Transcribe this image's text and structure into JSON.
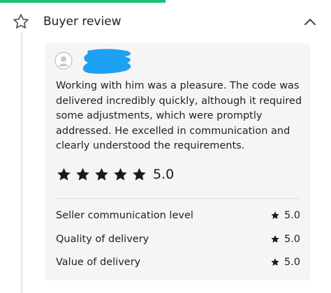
{
  "progress": {
    "fraction": 0.5,
    "color": "#1dbf73"
  },
  "header": {
    "title": "Buyer review",
    "icon": "star-outline-icon",
    "collapse_icon": "chevron-up-icon"
  },
  "review": {
    "text": "Working with him was a pleasure. The code was delivered incredibly quickly, although it required some adjustments, which were promptly addressed. He excelled in communication and clearly understood the requirements.",
    "stars": 5,
    "rating": "5.0",
    "redaction_color": "#1da1f2",
    "breakdown": [
      {
        "label": "Seller communication level",
        "score": "5.0"
      },
      {
        "label": "Quality of delivery",
        "score": "5.0"
      },
      {
        "label": "Value of delivery",
        "score": "5.0"
      }
    ]
  }
}
